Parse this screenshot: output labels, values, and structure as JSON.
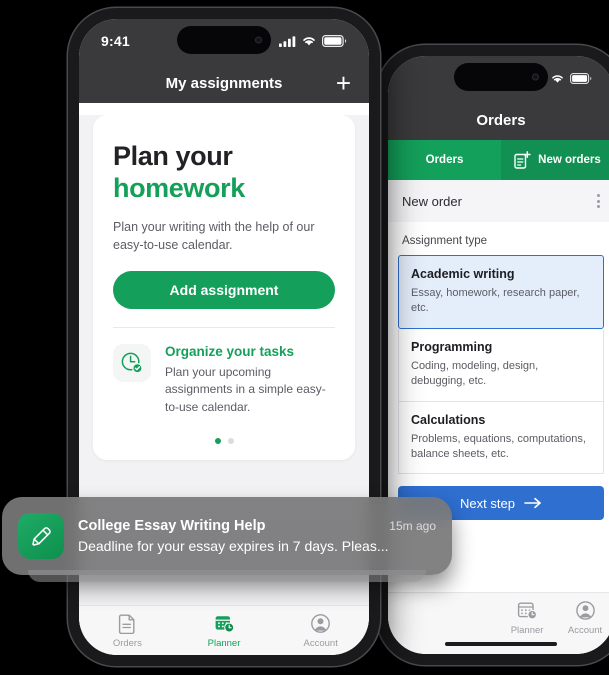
{
  "left_phone": {
    "status_bar": {
      "time": "9:41",
      "icons": [
        "cellular-icon",
        "wifi-icon",
        "battery-icon"
      ]
    },
    "nav": {
      "title": "My assignments",
      "add_label": "+"
    },
    "hero": {
      "line1": "Plan your",
      "line2": "homework",
      "subtitle": "Plan your writing with the help of our easy-to-use calendar.",
      "cta": "Add assignment"
    },
    "feature": {
      "icon": "clock-check-icon",
      "title": "Organize your tasks",
      "description": "Plan your upcoming assignments in a simple easy-to-use calendar."
    },
    "carousel": {
      "total": 2,
      "active": 0
    },
    "tabs": [
      {
        "label": "Orders",
        "icon": "document-icon",
        "active": false
      },
      {
        "label": "Planner",
        "icon": "calendar-clock-icon",
        "active": true
      },
      {
        "label": "Account",
        "icon": "person-circle-icon",
        "active": false
      }
    ]
  },
  "right_phone": {
    "status_bar": {
      "icons": [
        "cellular-icon",
        "wifi-icon",
        "battery-icon"
      ]
    },
    "nav": {
      "title": "Orders"
    },
    "segments": [
      {
        "label": "Orders",
        "icon": "",
        "selected": false
      },
      {
        "label": "New orders",
        "icon": "document-plus-icon",
        "selected": true
      }
    ],
    "row": {
      "title": "New order",
      "menu": "kebab-menu-icon"
    },
    "field_label": "Assignment type",
    "options": [
      {
        "title": "Academic writing",
        "description": "Essay, homework, research paper, etc.",
        "selected": true
      },
      {
        "title": "Programming",
        "description": "Coding, modeling, design, debugging, etc.",
        "selected": false
      },
      {
        "title": "Calculations",
        "description": "Problems, equations, computations, balance sheets, etc.",
        "selected": false
      }
    ],
    "next_button": {
      "label": "Next step",
      "icon": "arrow-right-icon"
    },
    "tabs": [
      {
        "label": "Planner",
        "icon": "calendar-clock-icon",
        "active": false
      },
      {
        "label": "Account",
        "icon": "person-circle-icon",
        "active": false
      }
    ]
  },
  "notification": {
    "icon": "pencil-icon",
    "title": "College Essay Writing Help",
    "time": "15m ago",
    "body": "Deadline for your essay expires in 7 days. Pleas..."
  },
  "colors": {
    "brand_green": "#14a05a",
    "accent_blue": "#2f6fd0",
    "selected_fill": "#e4eefb",
    "statusbar_grey": "#3a3a3c",
    "page_bg": "#f2f2f4"
  }
}
